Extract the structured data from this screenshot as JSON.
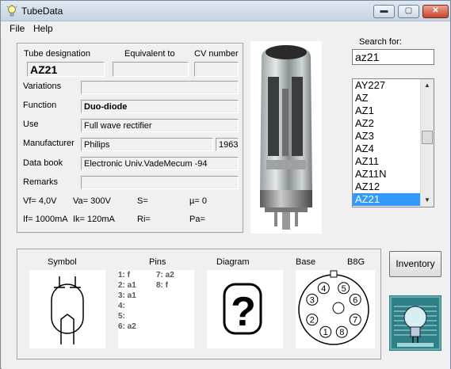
{
  "window": {
    "title": "TubeData",
    "min_glyph": "▬",
    "max_glyph": "▢",
    "close_glyph": "✕"
  },
  "menu": {
    "file": "File",
    "help": "Help"
  },
  "details": {
    "tube_designation_label": "Tube designation",
    "equivalent_label": "Equivalent to",
    "cv_label": "CV number",
    "tube_designation": "AZ21",
    "equivalent": "",
    "cv": "",
    "variations_label": "Variations",
    "variations": "",
    "function_label": "Function",
    "function": "Duo-diode",
    "use_label": "Use",
    "use": "Full wave rectifier",
    "manufacturer_label": "Manufacturer",
    "manufacturer": "Philips",
    "year": "1963",
    "databook_label": "Data book",
    "databook": "Electronic Univ.VadeMecum -94",
    "remarks_label": "Remarks",
    "remarks": "",
    "vf": "Vf= 4,0V",
    "va": "Va= 300V",
    "s": "S=",
    "mu": "µ=   0",
    "if": "If= 1000mA",
    "ik": "Ik=  120mA",
    "ri": "Ri=",
    "pa": "Pa="
  },
  "search": {
    "label": "Search for:",
    "value": "az21"
  },
  "list": {
    "items": [
      "AY227",
      "AZ",
      "AZ1",
      "AZ2",
      "AZ3",
      "AZ4",
      "AZ11",
      "AZ11N",
      "AZ12",
      "AZ21"
    ],
    "selected": "AZ21",
    "up_glyph": "▲",
    "down_glyph": "▼"
  },
  "bottom": {
    "symbol_label": "Symbol",
    "pins_label": "Pins",
    "diagram_label": "Diagram",
    "base_label": "Base",
    "base_type": "B8G",
    "diagram_glyph": "?",
    "pins_col1": [
      "1: f",
      "2: a1",
      "3: a1",
      "4:",
      "5:",
      "6: a2"
    ],
    "pins_col2": [
      "7: a2",
      "8: f"
    ],
    "base_pins": [
      "1",
      "2",
      "3",
      "4",
      "5",
      "6",
      "7",
      "8"
    ]
  },
  "inventory_label": "Inventory",
  "colors": {
    "selection": "#3399ff",
    "close_button": "#c5452b"
  }
}
